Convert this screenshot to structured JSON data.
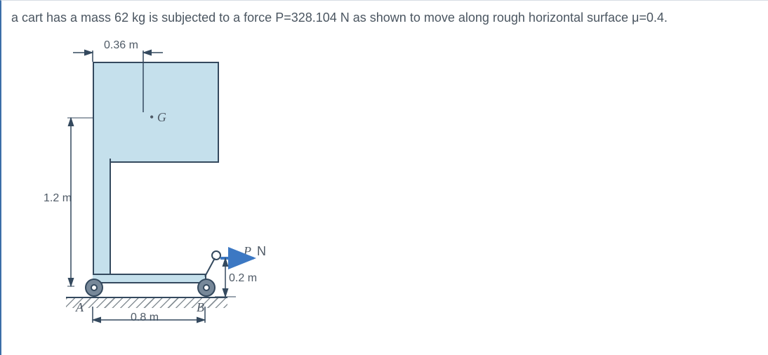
{
  "problem_text": "a cart has a mass 62 kg is subjected to a force P=328.104 N as shown to move along rough horizontal surface μ=0.4.",
  "labels": {
    "G": "G",
    "A": "A",
    "B": "B",
    "P": "P",
    "N": "N"
  },
  "dims": {
    "top_offset": "0.36 m",
    "height": "1.2 m",
    "base_width": "0.8 m",
    "push_height": "0.2 m"
  },
  "chart_data": {
    "type": "diagram",
    "body": "cart on rough horizontal surface",
    "mass_kg": 62,
    "applied_force_P_N": 328.104,
    "friction_coefficient_mu": 0.4,
    "geometry_m": {
      "center_of_mass_offset_from_A_x": 0.36,
      "center_of_mass_height": 1.2,
      "wheel_base_A_to_B": 0.8,
      "force_height_above_ground": 0.2
    },
    "points": [
      "A",
      "B",
      "G"
    ],
    "force": {
      "name": "P",
      "direction": "horizontal +x",
      "applied_at_height_m": 0.2
    }
  }
}
